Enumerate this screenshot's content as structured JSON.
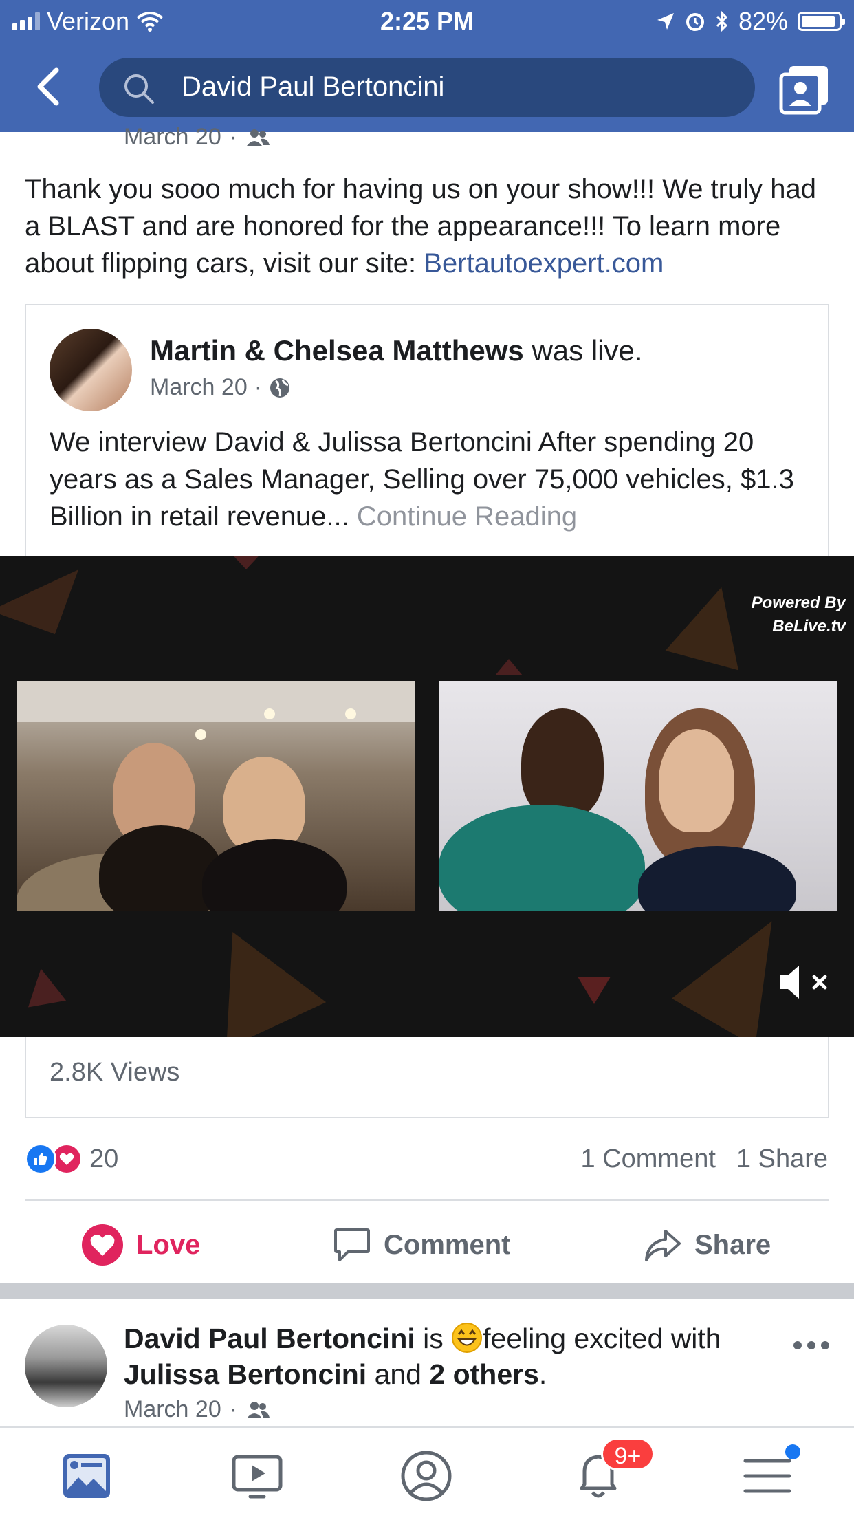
{
  "status_bar": {
    "carrier": "Verizon",
    "time": "2:25 PM",
    "battery": "82%",
    "battery_level": 0.82
  },
  "header": {
    "search_query": "David Paul Bertoncini",
    "icons": [
      "back-icon",
      "search-icon",
      "profile-switch-icon"
    ],
    "bg_color": "#4267b2"
  },
  "post1": {
    "date": "March 20",
    "audience": "friends-icon",
    "text": "Thank you sooo much for having us on your show!!! We truly had a BLAST and are honored for the appearance!!! To learn more about flipping cars, visit our site: ",
    "link": "Bertautoexpert.com",
    "shared": {
      "author": "Martin & Chelsea Matthews",
      "action": "was live.",
      "date": "March 20",
      "audience": "globe-icon",
      "description": "We interview David & Julissa Bertoncini  After spending 20 years as a Sales Manager, Selling over 75,000 vehicles, $1.3 Billion in retail revenue...",
      "continue": "Continue Reading",
      "video_watermark_1": "Powered By",
      "video_watermark_2": "BeLive.tv",
      "views": "2.8K Views"
    },
    "reaction_count": "20",
    "comments": "1 Comment",
    "shares": "1 Share",
    "actions": {
      "love": "Love",
      "comment": "Comment",
      "share": "Share"
    }
  },
  "post2": {
    "author": "David Paul Bertoncini",
    "is": "is",
    "feeling": "feeling excited with",
    "tagged": "Julissa Bertoncini",
    "and": "and",
    "others": "2 others",
    "period": ".",
    "date": "March 20"
  },
  "tabbar": {
    "tabs": [
      "news-feed-icon",
      "watch-icon",
      "profile-icon",
      "notifications-icon",
      "menu-icon"
    ],
    "notification_badge": "9+"
  },
  "colors": {
    "accent": "#4267b2",
    "link": "#385898",
    "love": "#e0245e",
    "badge": "#fa3e3e"
  }
}
